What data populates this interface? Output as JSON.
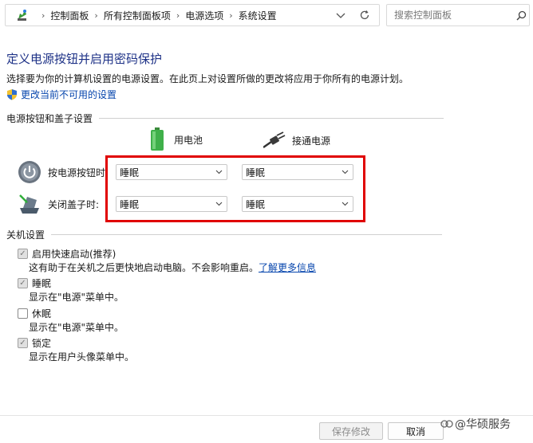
{
  "address": {
    "crumbs": [
      "控制面板",
      "所有控制面板项",
      "电源选项",
      "系统设置"
    ],
    "search_placeholder": "搜索控制面板"
  },
  "header": {
    "title": "定义电源按钮并启用密码保护",
    "description": "选择要为你的计算机设置的电源设置。在此页上对设置所做的更改将应用于你所有的电源计划。",
    "change_link": "更改当前不可用的设置"
  },
  "power_section": {
    "heading": "电源按钮和盖子设置",
    "columns": {
      "battery": "用电池",
      "plugged": "接通电源"
    },
    "rows": [
      {
        "label": "按电源按钮时:",
        "battery_value": "睡眠",
        "plugged_value": "睡眠"
      },
      {
        "label": "关闭盖子时:",
        "battery_value": "睡眠",
        "plugged_value": "睡眠"
      }
    ]
  },
  "shutdown_section": {
    "heading": "关机设置",
    "items": [
      {
        "label": "启用快速启动(推荐)",
        "checked": true,
        "description": "这有助于在关机之后更快地启动电脑。不会影响重启。",
        "link": "了解更多信息"
      },
      {
        "label": "睡眠",
        "checked": true,
        "description": "显示在\"电源\"菜单中。"
      },
      {
        "label": "休眠",
        "checked": false,
        "description": "显示在\"电源\"菜单中。"
      },
      {
        "label": "锁定",
        "checked": true,
        "description": "显示在用户头像菜单中。"
      }
    ]
  },
  "footer": {
    "save_label": "保存修改",
    "cancel_label": "取消"
  },
  "watermark": "@华硕服务",
  "colors": {
    "title": "#1e3287",
    "link": "#0645ad",
    "highlight": "#e00000"
  }
}
